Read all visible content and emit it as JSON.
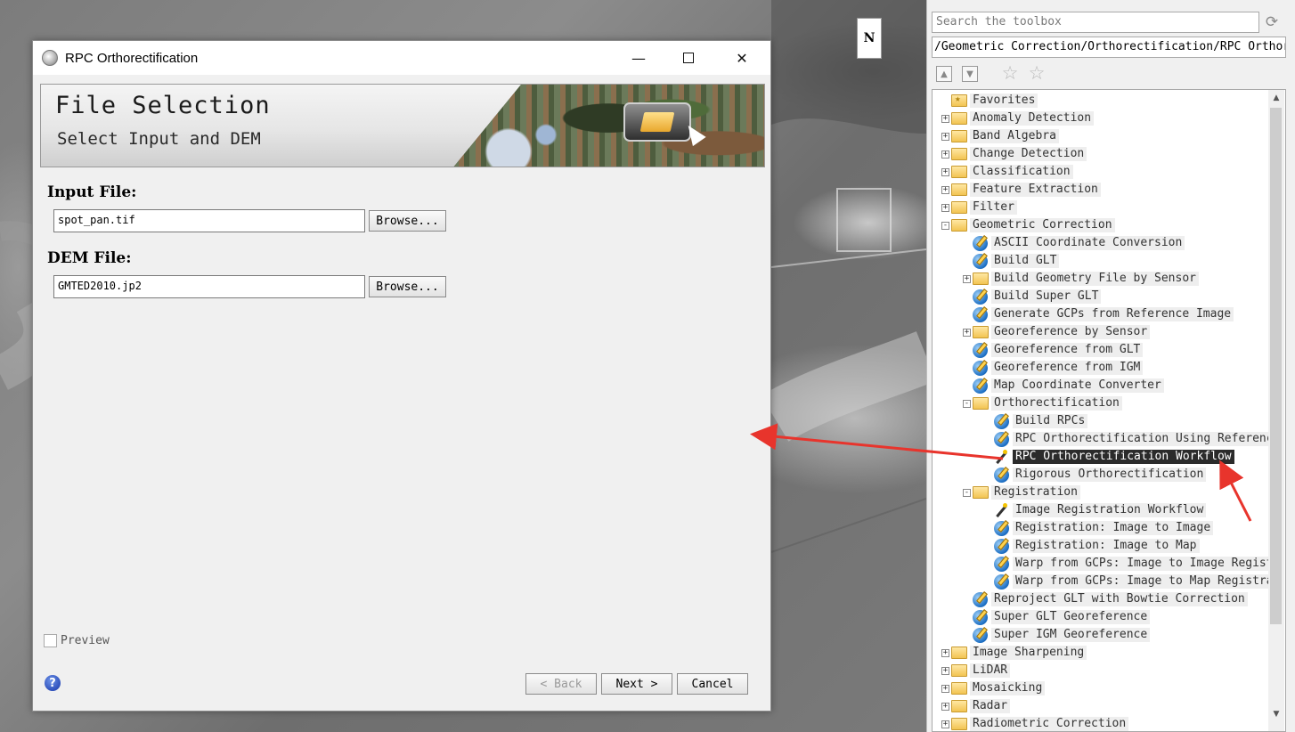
{
  "dialog": {
    "title": "RPC Orthorectification",
    "banner": {
      "title": "File Selection",
      "subtitle": "Select Input and DEM"
    },
    "input_label": "Input File:",
    "input_value": "spot_pan.tif",
    "dem_label": "DEM File:",
    "dem_value": "GMTED2010.jp2",
    "browse_label": "Browse...",
    "preview_label": "Preview",
    "back_label": "< Back",
    "next_label": "Next >",
    "cancel_label": "Cancel",
    "help_glyph": "?"
  },
  "toolbox": {
    "search_placeholder": "Search the toolbox",
    "path": "/Geometric Correction/Orthorectification/RPC Orthore",
    "tree": [
      {
        "label": "Favorites",
        "type": "folder-fav",
        "level": 0,
        "expander": "none"
      },
      {
        "label": "Anomaly Detection",
        "type": "folder",
        "level": 0,
        "expander": "+"
      },
      {
        "label": "Band Algebra",
        "type": "folder",
        "level": 0,
        "expander": "+"
      },
      {
        "label": "Change Detection",
        "type": "folder",
        "level": 0,
        "expander": "+"
      },
      {
        "label": "Classification",
        "type": "folder",
        "level": 0,
        "expander": "+"
      },
      {
        "label": "Feature Extraction",
        "type": "folder",
        "level": 0,
        "expander": "+"
      },
      {
        "label": "Filter",
        "type": "folder",
        "level": 0,
        "expander": "+"
      },
      {
        "label": "Geometric Correction",
        "type": "folder",
        "level": 0,
        "expander": "-"
      },
      {
        "label": "ASCII Coordinate Conversion",
        "type": "tool",
        "level": 1,
        "expander": "none"
      },
      {
        "label": "Build GLT",
        "type": "tool",
        "level": 1,
        "expander": "none"
      },
      {
        "label": "Build Geometry File by Sensor",
        "type": "folder",
        "level": 1,
        "expander": "+"
      },
      {
        "label": "Build Super GLT",
        "type": "tool",
        "level": 1,
        "expander": "none"
      },
      {
        "label": "Generate GCPs from Reference Image",
        "type": "tool",
        "level": 1,
        "expander": "none"
      },
      {
        "label": "Georeference by Sensor",
        "type": "folder",
        "level": 1,
        "expander": "+"
      },
      {
        "label": "Georeference from GLT",
        "type": "tool",
        "level": 1,
        "expander": "none"
      },
      {
        "label": "Georeference from IGM",
        "type": "tool",
        "level": 1,
        "expander": "none"
      },
      {
        "label": "Map Coordinate Converter",
        "type": "tool",
        "level": 1,
        "expander": "none"
      },
      {
        "label": "Orthorectification",
        "type": "folder",
        "level": 1,
        "expander": "-"
      },
      {
        "label": "Build RPCs",
        "type": "tool",
        "level": 2,
        "expander": "none"
      },
      {
        "label": "RPC Orthorectification Using Referenc",
        "type": "tool",
        "level": 2,
        "expander": "none"
      },
      {
        "label": "RPC Orthorectification Workflow",
        "type": "wand",
        "level": 2,
        "expander": "none",
        "selected": true
      },
      {
        "label": "Rigorous Orthorectification",
        "type": "tool",
        "level": 2,
        "expander": "none"
      },
      {
        "label": "Registration",
        "type": "folder",
        "level": 1,
        "expander": "-"
      },
      {
        "label": "Image Registration Workflow",
        "type": "wand",
        "level": 2,
        "expander": "none"
      },
      {
        "label": "Registration: Image to Image",
        "type": "tool",
        "level": 2,
        "expander": "none"
      },
      {
        "label": "Registration: Image to Map",
        "type": "tool",
        "level": 2,
        "expander": "none"
      },
      {
        "label": "Warp from GCPs: Image to Image Regist",
        "type": "tool",
        "level": 2,
        "expander": "none"
      },
      {
        "label": "Warp from GCPs: Image to Map Registra",
        "type": "tool",
        "level": 2,
        "expander": "none"
      },
      {
        "label": "Reproject GLT with Bowtie Correction",
        "type": "tool",
        "level": 1,
        "expander": "none"
      },
      {
        "label": "Super GLT Georeference",
        "type": "tool",
        "level": 1,
        "expander": "none"
      },
      {
        "label": "Super IGM Georeference",
        "type": "tool",
        "level": 1,
        "expander": "none"
      },
      {
        "label": "Image Sharpening",
        "type": "folder",
        "level": 0,
        "expander": "+"
      },
      {
        "label": "LiDAR",
        "type": "folder",
        "level": 0,
        "expander": "+"
      },
      {
        "label": "Mosaicking",
        "type": "folder",
        "level": 0,
        "expander": "+"
      },
      {
        "label": "Radar",
        "type": "folder",
        "level": 0,
        "expander": "+"
      },
      {
        "label": "Radiometric Correction",
        "type": "folder",
        "level": 0,
        "expander": "+"
      }
    ]
  },
  "map": {
    "north_label": "N"
  },
  "colors": {
    "annotation_arrow": "#e8342c",
    "selected_row_bg": "#2b2b2b"
  }
}
